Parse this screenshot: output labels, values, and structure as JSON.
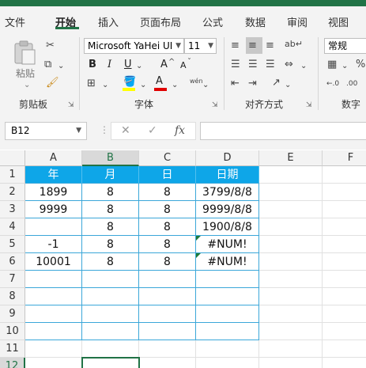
{
  "ribbon": {
    "tabs": [
      "文件",
      "开始",
      "插入",
      "页面布局",
      "公式",
      "数据",
      "审阅",
      "视图"
    ],
    "active_tab": "开始",
    "clipboard": {
      "paste_label": "粘贴",
      "group_label": "剪贴板"
    },
    "font": {
      "name": "Microsoft YaHei UI",
      "size": "11",
      "bold": "B",
      "italic": "I",
      "underline": "U",
      "grow": "A",
      "shrink": "A",
      "phonetic": "wén",
      "group_label": "字体"
    },
    "alignment": {
      "group_label": "对齐方式"
    },
    "number": {
      "format": "常规",
      "group_label": "数字"
    }
  },
  "formula_bar": {
    "name_box": "B12",
    "cancel": "✕",
    "enter": "✓",
    "fx": "fx",
    "content": ""
  },
  "sheet": {
    "columns": [
      "A",
      "B",
      "C",
      "D",
      "E",
      "F"
    ],
    "selected_column": "B",
    "selected_row": "12",
    "rows": [
      "1",
      "2",
      "3",
      "4",
      "5",
      "6",
      "7",
      "8",
      "9",
      "10",
      "11",
      "12"
    ],
    "header_row": [
      "年",
      "月",
      "日",
      "日期"
    ],
    "data": [
      [
        "1899",
        "8",
        "8",
        "3799/8/8"
      ],
      [
        "9999",
        "8",
        "8",
        "9999/8/8"
      ],
      [
        "",
        "8",
        "8",
        "1900/8/8"
      ],
      [
        "-1",
        "8",
        "8",
        "#NUM!"
      ],
      [
        "10001",
        "8",
        "8",
        "#NUM!"
      ]
    ],
    "active_cell": "B12",
    "colors": {
      "header_fill": "#0EA6E8",
      "header_text": "#FFFFFF",
      "table_border": "#3BA7D9",
      "accent": "#217346"
    }
  }
}
